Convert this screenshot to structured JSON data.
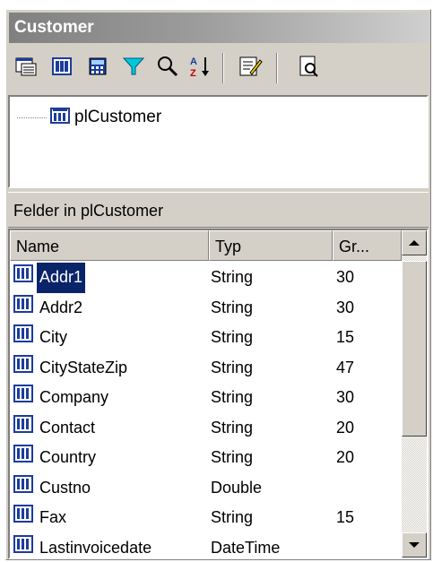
{
  "panel": {
    "title": "Customer"
  },
  "toolbar": {
    "buttons": [
      {
        "icon": "properties-icon"
      },
      {
        "icon": "pipeline-icon"
      },
      {
        "icon": "calculator-icon"
      },
      {
        "icon": "filter-icon"
      },
      {
        "icon": "search-icon"
      },
      {
        "icon": "sort-az-icon"
      },
      {
        "icon": "edit-icon"
      },
      {
        "icon": "preview-icon"
      }
    ]
  },
  "tree": {
    "items": [
      {
        "label": "plCustomer",
        "icon": "pipeline-icon"
      }
    ]
  },
  "fields": {
    "header": "Felder in plCustomer",
    "columns": [
      "Name",
      "Typ",
      "Gr..."
    ],
    "rows": [
      {
        "name": "Addr1",
        "typ": "String",
        "gr": "30",
        "selected": true
      },
      {
        "name": "Addr2",
        "typ": "String",
        "gr": "30"
      },
      {
        "name": "City",
        "typ": "String",
        "gr": "15"
      },
      {
        "name": "CityStateZip",
        "typ": "String",
        "gr": "47"
      },
      {
        "name": "Company",
        "typ": "String",
        "gr": "30"
      },
      {
        "name": "Contact",
        "typ": "String",
        "gr": "20"
      },
      {
        "name": "Country",
        "typ": "String",
        "gr": "20"
      },
      {
        "name": "Custno",
        "typ": "Double",
        "gr": ""
      },
      {
        "name": "Fax",
        "typ": "String",
        "gr": "15"
      },
      {
        "name": "Lastinvoicedate",
        "typ": "DateTime",
        "gr": ""
      }
    ]
  },
  "colors": {
    "selection": "#0a246a",
    "face": "#d4d0c8",
    "field_icon_blue": "#1c3c9c"
  }
}
